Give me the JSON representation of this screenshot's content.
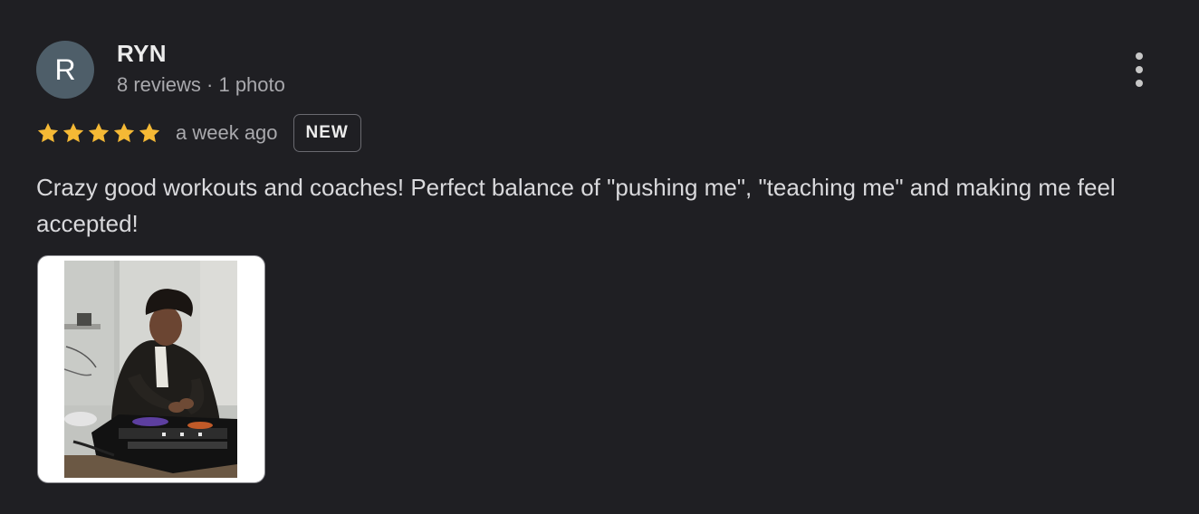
{
  "reviewer": {
    "avatar_initial": "R",
    "avatar_color": "#4e5e69",
    "name": "RYN",
    "meta": "8 reviews · 1 photo"
  },
  "menu": {
    "icon": "more-vert-icon"
  },
  "rating": {
    "stars": 5,
    "max_stars": 5,
    "star_color": "#f5b935",
    "time": "a week ago",
    "badge": "NEW"
  },
  "review": {
    "text": "Crazy good workouts and coaches! Perfect balance of \"pushing me\", \"teaching me\" and making me feel accepted!"
  },
  "photos": [
    {
      "description": "person DJing at a controller"
    }
  ]
}
